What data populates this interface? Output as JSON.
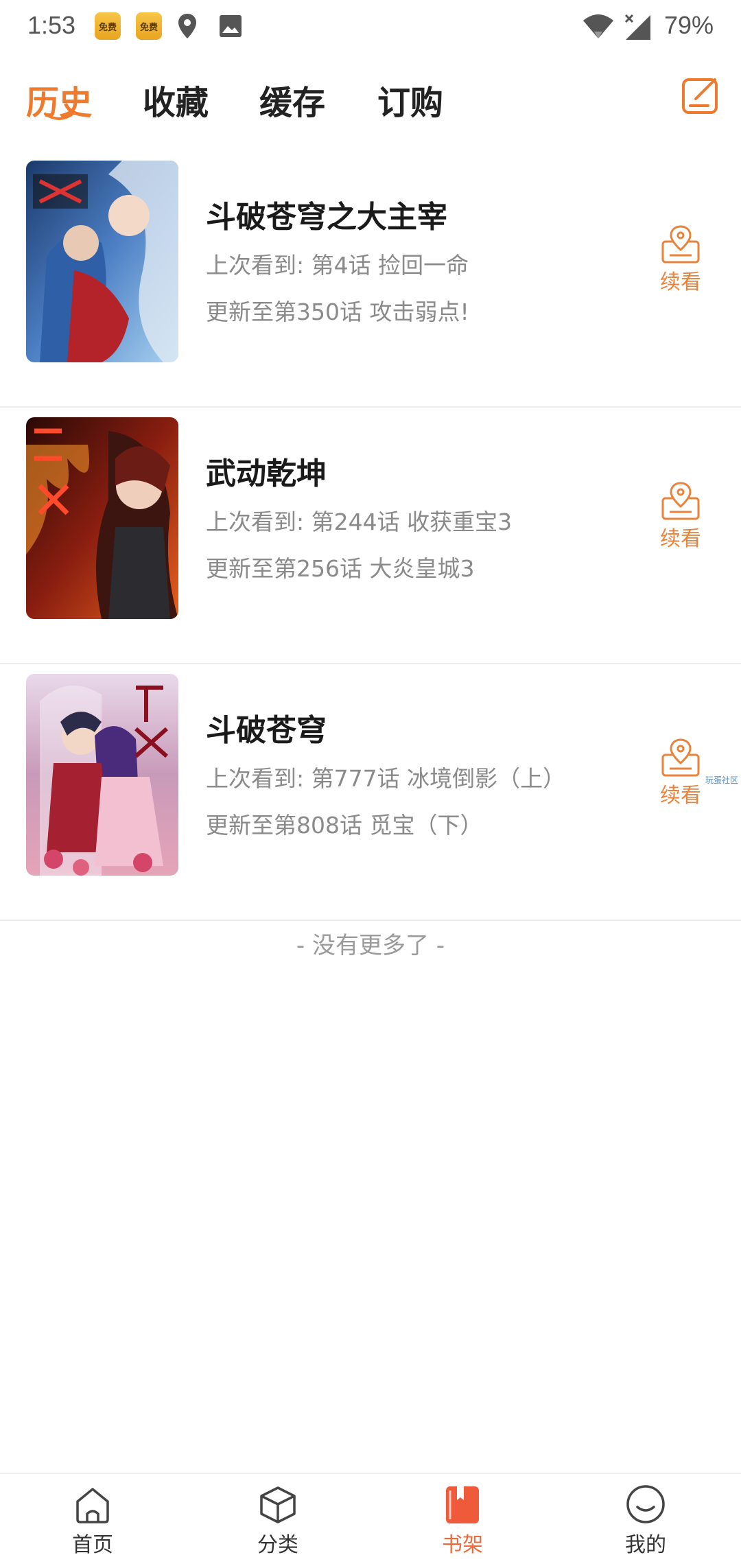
{
  "status_bar": {
    "time": "1:53",
    "badge1": "免费",
    "badge2": "免费",
    "battery": "79%"
  },
  "tabs": [
    {
      "label": "历史",
      "active": true
    },
    {
      "label": "收藏",
      "active": false
    },
    {
      "label": "缓存",
      "active": false
    },
    {
      "label": "订购",
      "active": false
    }
  ],
  "items": [
    {
      "title": "斗破苍穹之大主宰",
      "last_read": "上次看到: 第4话 捡回一命",
      "update": "更新至第350话 攻击弱点!",
      "action": "续看"
    },
    {
      "title": "武动乾坤",
      "last_read": "上次看到: 第244话 收获重宝3",
      "update": "更新至第256话 大炎皇城3",
      "action": "续看"
    },
    {
      "title": "斗破苍穹",
      "last_read": "上次看到: 第777话 冰境倒影（上）",
      "update": "更新至第808话 觅宝（下）",
      "action": "续看"
    }
  ],
  "watermark": "玩蛋社区",
  "end_text": "- 没有更多了 -",
  "nav": [
    {
      "label": "首页",
      "active": false
    },
    {
      "label": "分类",
      "active": false
    },
    {
      "label": "书架",
      "active": true
    },
    {
      "label": "我的",
      "active": false
    }
  ],
  "colors": {
    "accent": "#ef7a2c",
    "continue": "#e9833b",
    "nav_active": "#ef6a3a"
  }
}
